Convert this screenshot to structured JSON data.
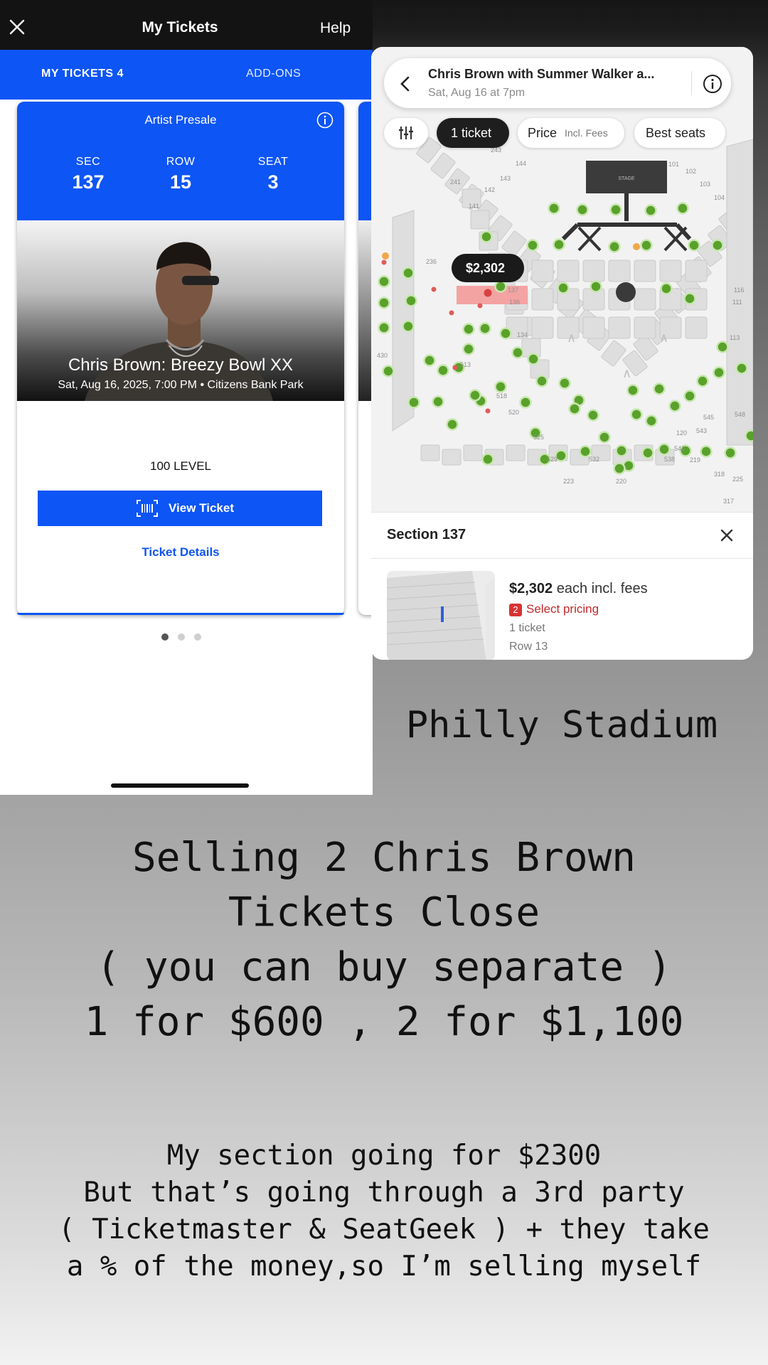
{
  "app": {
    "title": "My Tickets",
    "help_label": "Help",
    "tabs": [
      {
        "label": "MY TICKETS 4",
        "active": true
      },
      {
        "label": "ADD-ONS",
        "active": false
      }
    ],
    "accent": "#0d55f5"
  },
  "ticket": {
    "presale": "Artist Presale",
    "sec_label": "SEC",
    "sec": "137",
    "row_label": "ROW",
    "row": "15",
    "seat_label": "SEAT",
    "seat": "3",
    "event": "Chris Brown: Breezy Bowl XX",
    "datetime_venue": "Sat, Aug 16, 2025, 7:00 PM • Citizens Bank Park",
    "level": "100 LEVEL",
    "view_button": "View Ticket",
    "details_link": "Ticket Details",
    "pager": {
      "current": 1,
      "total": 3
    }
  },
  "seatmap": {
    "event_title": "Chris Brown with Summer Walker a...",
    "event_date": "Sat, Aug 16 at 7pm",
    "chips": {
      "tickets": "1 ticket",
      "price": "Price",
      "price_sub": "Incl. Fees",
      "best": "Best seats"
    },
    "price_tag": "$2,302",
    "stage_label": "STAGE",
    "section_labels": [
      "144",
      "143",
      "142",
      "141",
      "241",
      "236",
      "137",
      "136",
      "134",
      "430",
      "513",
      "518",
      "520",
      "525",
      "529",
      "532",
      "538",
      "541",
      "543",
      "545",
      "548",
      "120",
      "219",
      "220",
      "223",
      "225",
      "317",
      "318",
      "113",
      "111",
      "116",
      "101",
      "102",
      "103",
      "104",
      "243"
    ],
    "sheet": {
      "section": "Section 137",
      "price": "$2,302",
      "price_suffix": " each incl. fees",
      "pricing_badge": "2",
      "pricing_label": "Select pricing",
      "quantity": "1 ticket",
      "row": "Row 13"
    }
  },
  "captions": {
    "venue": "Philly Stadium",
    "main": "Selling 2 Chris Brown\nTickets Close\n( you can buy separate )\n1 for $600 , 2 for $1,100",
    "note": "My section going for $2300\nBut that’s going through a 3rd party\n( Ticketmaster & SeatGeek ) + they take\na % of the money,so I’m selling myself"
  }
}
